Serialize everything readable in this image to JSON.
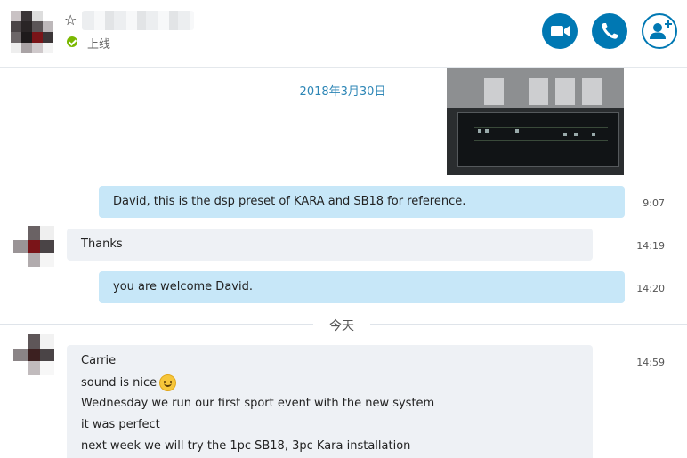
{
  "header": {
    "status": "上线",
    "icons": [
      "star-icon",
      "video-camera-icon",
      "phone-icon",
      "add-person-icon"
    ],
    "accent": "#0078b3"
  },
  "messages": {
    "date_header": "2018年3月30日",
    "m1": {
      "text": "David, this is the dsp preset of KARA and SB18 for reference.",
      "time": "9:07"
    },
    "m2": {
      "text": "Thanks",
      "time": "14:19"
    },
    "m3": {
      "text": "you are welcome David.",
      "time": "14:20"
    },
    "divider": "今天",
    "m4": {
      "time": "14:59",
      "lines": [
        "Carrie",
        "sound is nice",
        "Wednesday we run our first sport event with the new system",
        "it was perfect",
        "next week we will try the 1pc SB18, 3pc Kara installation"
      ]
    }
  },
  "colors": {
    "outgoing_bubble": "#c7e7f8",
    "incoming_bubble": "#eef1f5",
    "online": "#7ab800"
  }
}
